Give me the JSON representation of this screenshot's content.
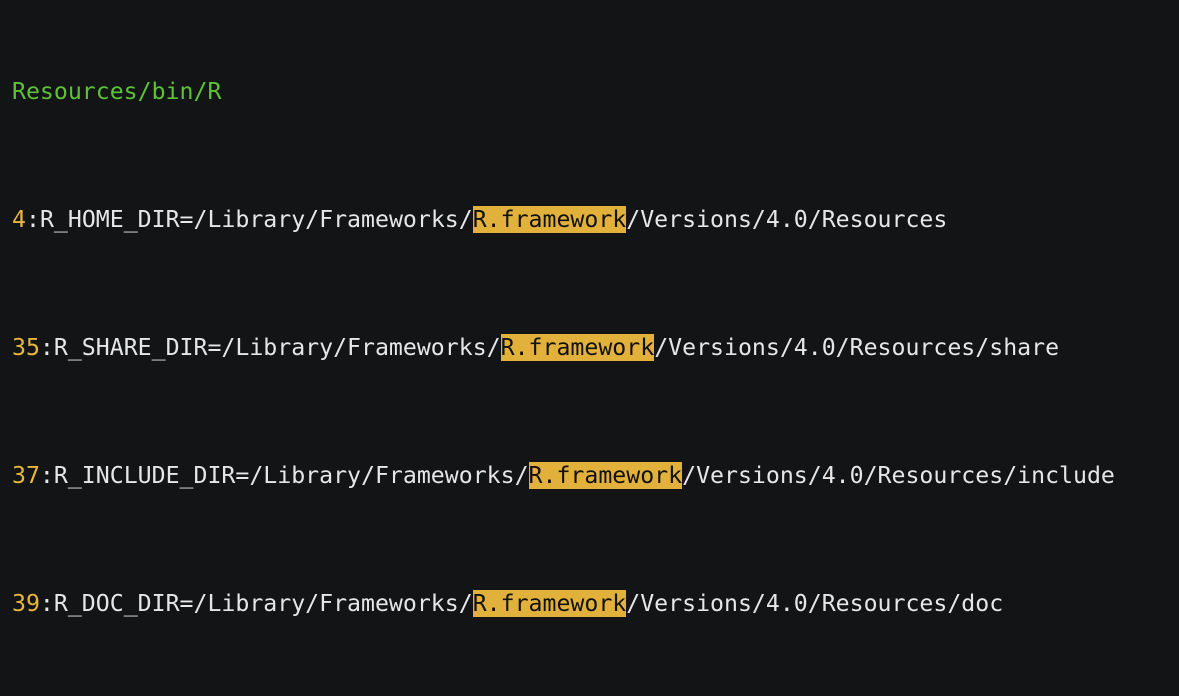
{
  "colors": {
    "background": "#131416",
    "text": "#e6e6e6",
    "file_path": "#5dc237",
    "line_number": "#e8b63d",
    "match_highlight": "#e2b13c"
  },
  "file": "Resources/bin/R",
  "results": [
    {
      "line": "4",
      "sep": ":",
      "before": "R_HOME_DIR=/Library/Frameworks/",
      "match": "R.framework",
      "after": "/Versions/4.0/Resources"
    },
    {
      "line": "35",
      "sep": ":",
      "before": "R_SHARE_DIR=/Library/Frameworks/",
      "match": "R.framework",
      "after": "/Versions/4.0/Resources/share"
    },
    {
      "line": "37",
      "sep": ":",
      "before": "R_INCLUDE_DIR=/Library/Frameworks/",
      "match": "R.framework",
      "after": "/Versions/4.0/Resources/include"
    },
    {
      "line": "39",
      "sep": ":",
      "before": "R_DOC_DIR=/Library/Frameworks/",
      "match": "R.framework",
      "after": "/Versions/4.0/Resources/doc"
    }
  ]
}
